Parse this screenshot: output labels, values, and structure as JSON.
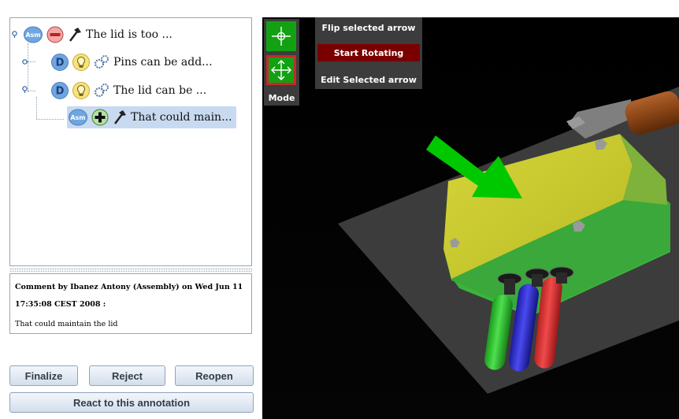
{
  "tree": {
    "nodes": [
      {
        "badge": "Asm",
        "action": "minus",
        "tool": "hammer",
        "label": "The lid is too ..."
      },
      {
        "badge": "D",
        "action": "bulb",
        "tool": "gears",
        "label": "Pins can be add..."
      },
      {
        "badge": "D",
        "action": "bulb",
        "tool": "gears",
        "label": "The lid can be ..."
      },
      {
        "badge": "Asm",
        "action": "plus",
        "tool": "hammer",
        "label": "That could main...",
        "selected": true
      }
    ]
  },
  "comment": {
    "header_line1": "Comment by Ibanez Antony (Assembly) on Wed Jun 11",
    "header_line2": "17:35:08 CEST 2008 :",
    "body": "That could maintain the lid"
  },
  "buttons": {
    "finalize": "Finalize",
    "reject": "Reject",
    "reopen": "Reopen",
    "react": "React to this annotation"
  },
  "viewer": {
    "mode_label": "Mode",
    "menu": {
      "flip": "Flip selected arrow",
      "start_rotating": "Start Rotating",
      "edit": "Edit Selected arrow"
    }
  },
  "colors": {
    "selection": "#c8daf0",
    "mode_active": "#13a113",
    "mode_selected_border": "#c42a2a",
    "start_rotating_bg": "#7a0000",
    "lid": "#c8c832",
    "box": "#3ca83c",
    "annotation_arrow": "#00c800"
  }
}
